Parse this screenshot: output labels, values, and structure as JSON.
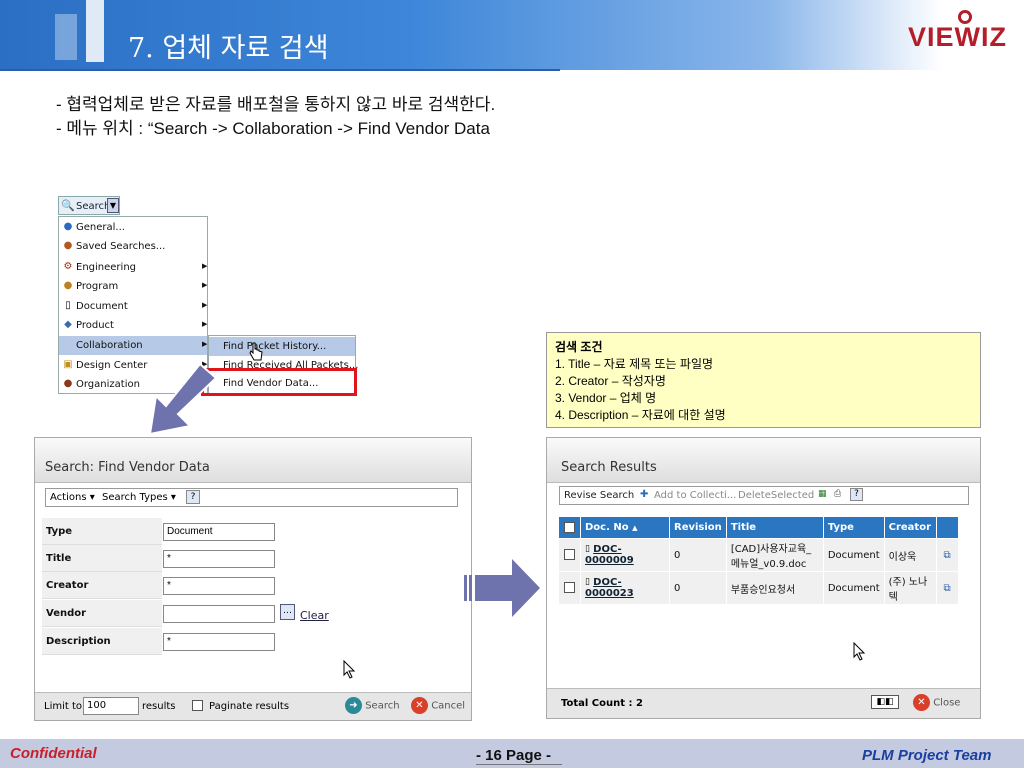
{
  "header": {
    "title": "7. 업체 자료 검색",
    "logo": "VIEWIZ"
  },
  "intro": {
    "line1": "- 협력업체로 받은 자료를 배포철을 통하지 않고 바로 검색한다.",
    "line2": "- 메뉴 위치 : “Search -> Collaboration -> Find Vendor Data"
  },
  "menu": {
    "button_label": "Search",
    "items": [
      {
        "label": "General...",
        "icon": "globe-icon",
        "has_submenu": false
      },
      {
        "label": "Saved Searches...",
        "icon": "bag-icon",
        "has_submenu": false
      },
      {
        "label": "Engineering",
        "icon": "gear-icon",
        "has_submenu": true
      },
      {
        "label": "Program",
        "icon": "program-icon",
        "has_submenu": true
      },
      {
        "label": "Document",
        "icon": "document-icon",
        "has_submenu": true
      },
      {
        "label": "Product",
        "icon": "product-icon",
        "has_submenu": true
      },
      {
        "label": "Collaboration",
        "icon": "collaboration-icon",
        "has_submenu": true,
        "active": true
      },
      {
        "label": "Design Center",
        "icon": "design-center-icon",
        "has_submenu": true
      },
      {
        "label": "Organization",
        "icon": "organization-icon",
        "has_submenu": true
      }
    ],
    "submenu": [
      {
        "label": "Find Packet History...",
        "active": true
      },
      {
        "label": "Find Received All Packets..."
      },
      {
        "label": "Find Vendor Data..."
      }
    ]
  },
  "search_panel": {
    "title": "Search: Find Vendor Data",
    "toolbar": {
      "actions": "Actions",
      "search_types": "Search Types"
    },
    "fields": [
      {
        "label": "Type",
        "value": "Document"
      },
      {
        "label": "Title",
        "value": "*"
      },
      {
        "label": "Creator",
        "value": "*"
      },
      {
        "label": "Vendor",
        "value": "",
        "clear_label": "Clear"
      },
      {
        "label": "Description",
        "value": "*"
      }
    ],
    "footer": {
      "limit_label": "Limit to",
      "limit_value": "100",
      "results_label": "results",
      "paginate_label": "Paginate results",
      "search_label": "Search",
      "cancel_label": "Cancel"
    }
  },
  "criteria": {
    "title": "검색 조건",
    "lines": [
      "1. Title – 자료 제목 또는 파일명",
      "2. Creator – 작성자명",
      "3. Vendor – 업체 명",
      "4. Description – 자료에 대한 설명"
    ]
  },
  "results_panel": {
    "title": "Search Results",
    "toolbar": {
      "revise": "Revise Search",
      "add": "Add to Collecti...",
      "delete": "DeleteSelected"
    },
    "columns": [
      "Doc. No",
      "Revision",
      "Title",
      "Type",
      "Creator"
    ],
    "rows": [
      {
        "doc_no": "DOC-0000009",
        "revision": "0",
        "title": "[CAD]사용자교육_메뉴얼_v0.9.doc",
        "type": "Document",
        "creator": "이상욱"
      },
      {
        "doc_no": "DOC-0000023",
        "revision": "0",
        "title": "부품승인요청서",
        "type": "Document",
        "creator": "(주) 노나텍"
      }
    ],
    "footer": {
      "total": "Total Count : 2",
      "close_label": "Close"
    }
  },
  "footer": {
    "confidential": "Confidential",
    "page": "- 16 Page -",
    "team": "PLM  Project Team"
  },
  "colors": {
    "header_blue": "#3d86d9",
    "highlight_red": "#e0141c",
    "table_header": "#2a76c0",
    "criteria_bg": "#ffffc4"
  }
}
